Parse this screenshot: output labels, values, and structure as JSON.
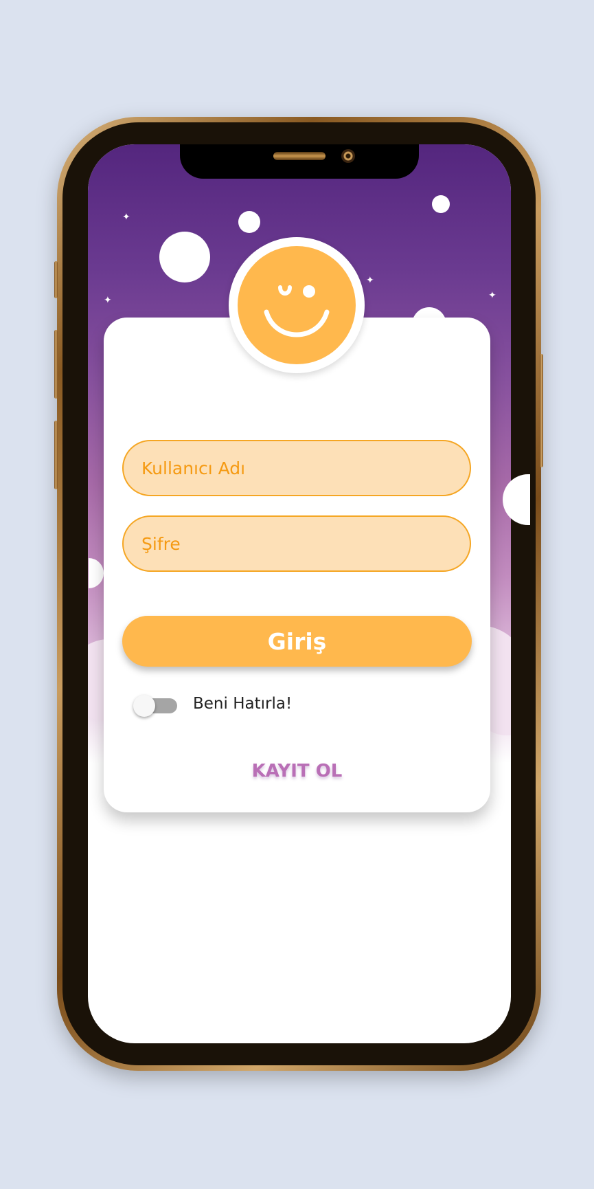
{
  "login": {
    "username_placeholder": "Kullanıcı Adı",
    "password_placeholder": "Şifre",
    "login_button": "Giriş",
    "remember_label": "Beni Hatırla!",
    "remember_enabled": false,
    "register_link": "KAYIT OL"
  },
  "colors": {
    "accent": "#ffb84d",
    "field_fill": "#fde0b7",
    "field_border": "#f5a623",
    "link": "#b96fb6",
    "sky_top": "#54267e"
  },
  "icons": [
    "smiley-logo-icon"
  ]
}
